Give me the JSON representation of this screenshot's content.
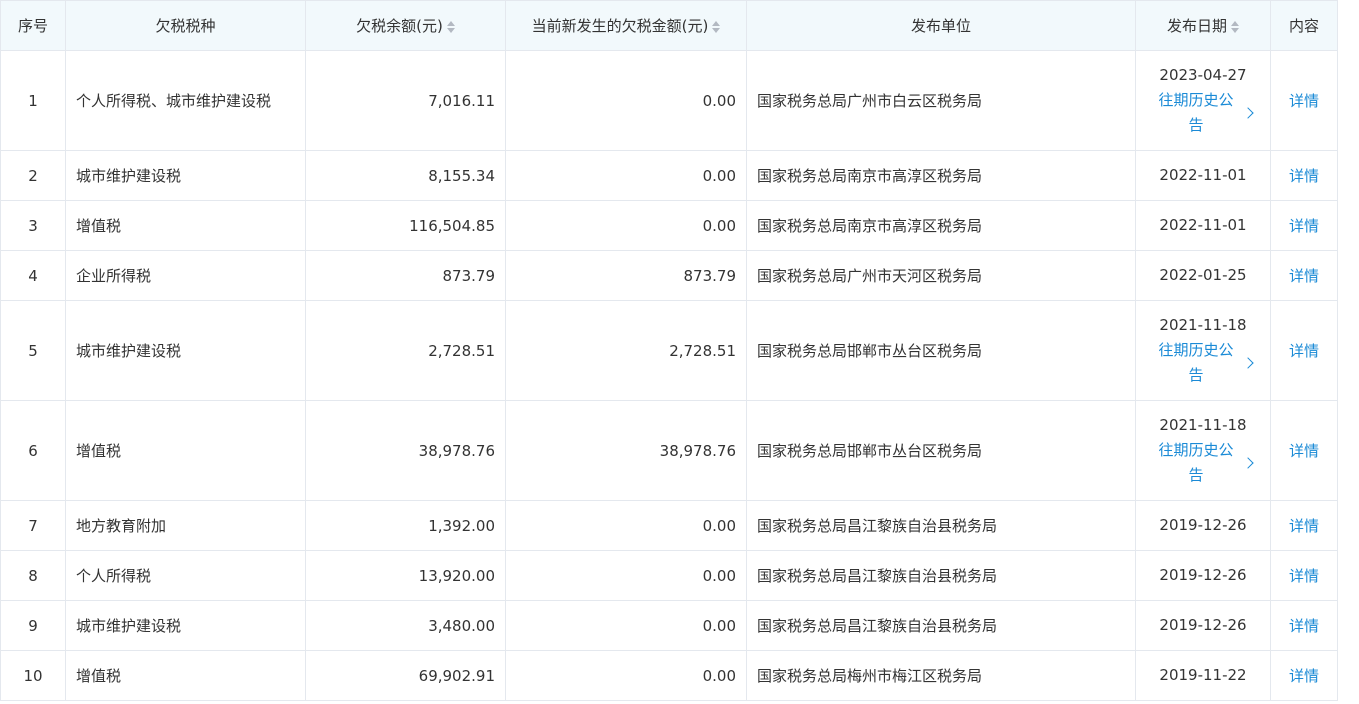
{
  "headers": {
    "index": "序号",
    "tax_type": "欠税税种",
    "balance": "欠税余额(元)",
    "new_amount": "当前新发生的欠税金额(元)",
    "unit": "发布单位",
    "date": "发布日期",
    "content": "内容"
  },
  "history_label": "往期历史公告",
  "detail_label": "详情",
  "rows": [
    {
      "index": "1",
      "tax_type": "个人所得税、城市维护建设税",
      "balance": "7,016.11",
      "new_amount": "0.00",
      "unit": "国家税务总局广州市白云区税务局",
      "date": "2023-04-27",
      "history": true
    },
    {
      "index": "2",
      "tax_type": "城市维护建设税",
      "balance": "8,155.34",
      "new_amount": "0.00",
      "unit": "国家税务总局南京市高淳区税务局",
      "date": "2022-11-01",
      "history": false
    },
    {
      "index": "3",
      "tax_type": "增值税",
      "balance": "116,504.85",
      "new_amount": "0.00",
      "unit": "国家税务总局南京市高淳区税务局",
      "date": "2022-11-01",
      "history": false
    },
    {
      "index": "4",
      "tax_type": "企业所得税",
      "balance": "873.79",
      "new_amount": "873.79",
      "unit": "国家税务总局广州市天河区税务局",
      "date": "2022-01-25",
      "history": false
    },
    {
      "index": "5",
      "tax_type": "城市维护建设税",
      "balance": "2,728.51",
      "new_amount": "2,728.51",
      "unit": "国家税务总局邯郸市丛台区税务局",
      "date": "2021-11-18",
      "history": true
    },
    {
      "index": "6",
      "tax_type": "增值税",
      "balance": "38,978.76",
      "new_amount": "38,978.76",
      "unit": "国家税务总局邯郸市丛台区税务局",
      "date": "2021-11-18",
      "history": true
    },
    {
      "index": "7",
      "tax_type": "地方教育附加",
      "balance": "1,392.00",
      "new_amount": "0.00",
      "unit": "国家税务总局昌江黎族自治县税务局",
      "date": "2019-12-26",
      "history": false
    },
    {
      "index": "8",
      "tax_type": "个人所得税",
      "balance": "13,920.00",
      "new_amount": "0.00",
      "unit": "国家税务总局昌江黎族自治县税务局",
      "date": "2019-12-26",
      "history": false
    },
    {
      "index": "9",
      "tax_type": "城市维护建设税",
      "balance": "3,480.00",
      "new_amount": "0.00",
      "unit": "国家税务总局昌江黎族自治县税务局",
      "date": "2019-12-26",
      "history": false
    },
    {
      "index": "10",
      "tax_type": "增值税",
      "balance": "69,902.91",
      "new_amount": "0.00",
      "unit": "国家税务总局梅州市梅江区税务局",
      "date": "2019-11-22",
      "history": false
    }
  ]
}
